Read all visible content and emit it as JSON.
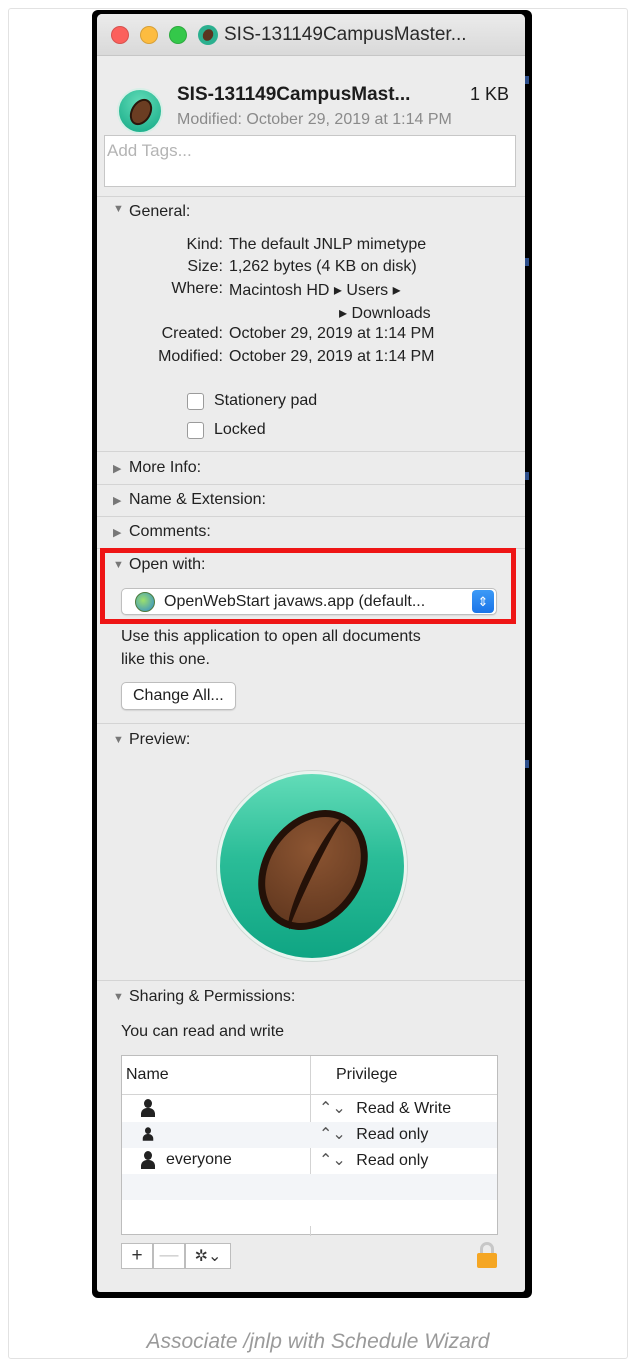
{
  "window": {
    "title": "SIS-131149CampusMaster...",
    "traffic_lights": [
      "close",
      "minimize",
      "zoom"
    ]
  },
  "header": {
    "file_name": "SIS-131149CampusMast...",
    "file_size": "1 KB",
    "modified": "Modified: October 29, 2019 at 1:14 PM"
  },
  "tags": {
    "placeholder": "Add Tags..."
  },
  "general": {
    "heading": "General:",
    "rows": [
      {
        "label": "Kind:",
        "value": "The default JNLP mimetype"
      },
      {
        "label": "Size:",
        "value": "1,262 bytes (4 KB on disk)"
      },
      {
        "label": "Where:",
        "value": "Macintosh HD ▸ Users ▸"
      },
      {
        "label": "",
        "value": "▸ Downloads"
      },
      {
        "label": "Created:",
        "value": "October 29, 2019 at 1:14 PM"
      },
      {
        "label": "Modified:",
        "value": "October 29, 2019 at 1:14 PM"
      }
    ],
    "stationery_pad": "Stationery pad",
    "locked": "Locked"
  },
  "sections": {
    "more_info": "More Info:",
    "name_extension": "Name & Extension:",
    "comments": "Comments:",
    "open_with": "Open with:",
    "preview": "Preview:",
    "sharing": "Sharing & Permissions:"
  },
  "open_with": {
    "app": "OpenWebStart javaws.app (default...",
    "description_line1": "Use this application to open all documents",
    "description_line2": "like this one.",
    "change_all": "Change All..."
  },
  "sharing": {
    "status": "You can read and write",
    "columns": [
      "Name",
      "Privilege"
    ],
    "rows": [
      {
        "name": "",
        "privilege": "Read & Write"
      },
      {
        "name": "",
        "privilege": "Read only"
      },
      {
        "name": "everyone",
        "privilege": "Read only"
      }
    ],
    "add": "+",
    "remove": "—",
    "action": "✲⌄"
  },
  "caption": "Associate /jnlp with Schedule Wizard",
  "colors": {
    "highlight": "#ee1515",
    "accent_blue": "#1a74e8",
    "preview_green": "#2bbd98"
  }
}
